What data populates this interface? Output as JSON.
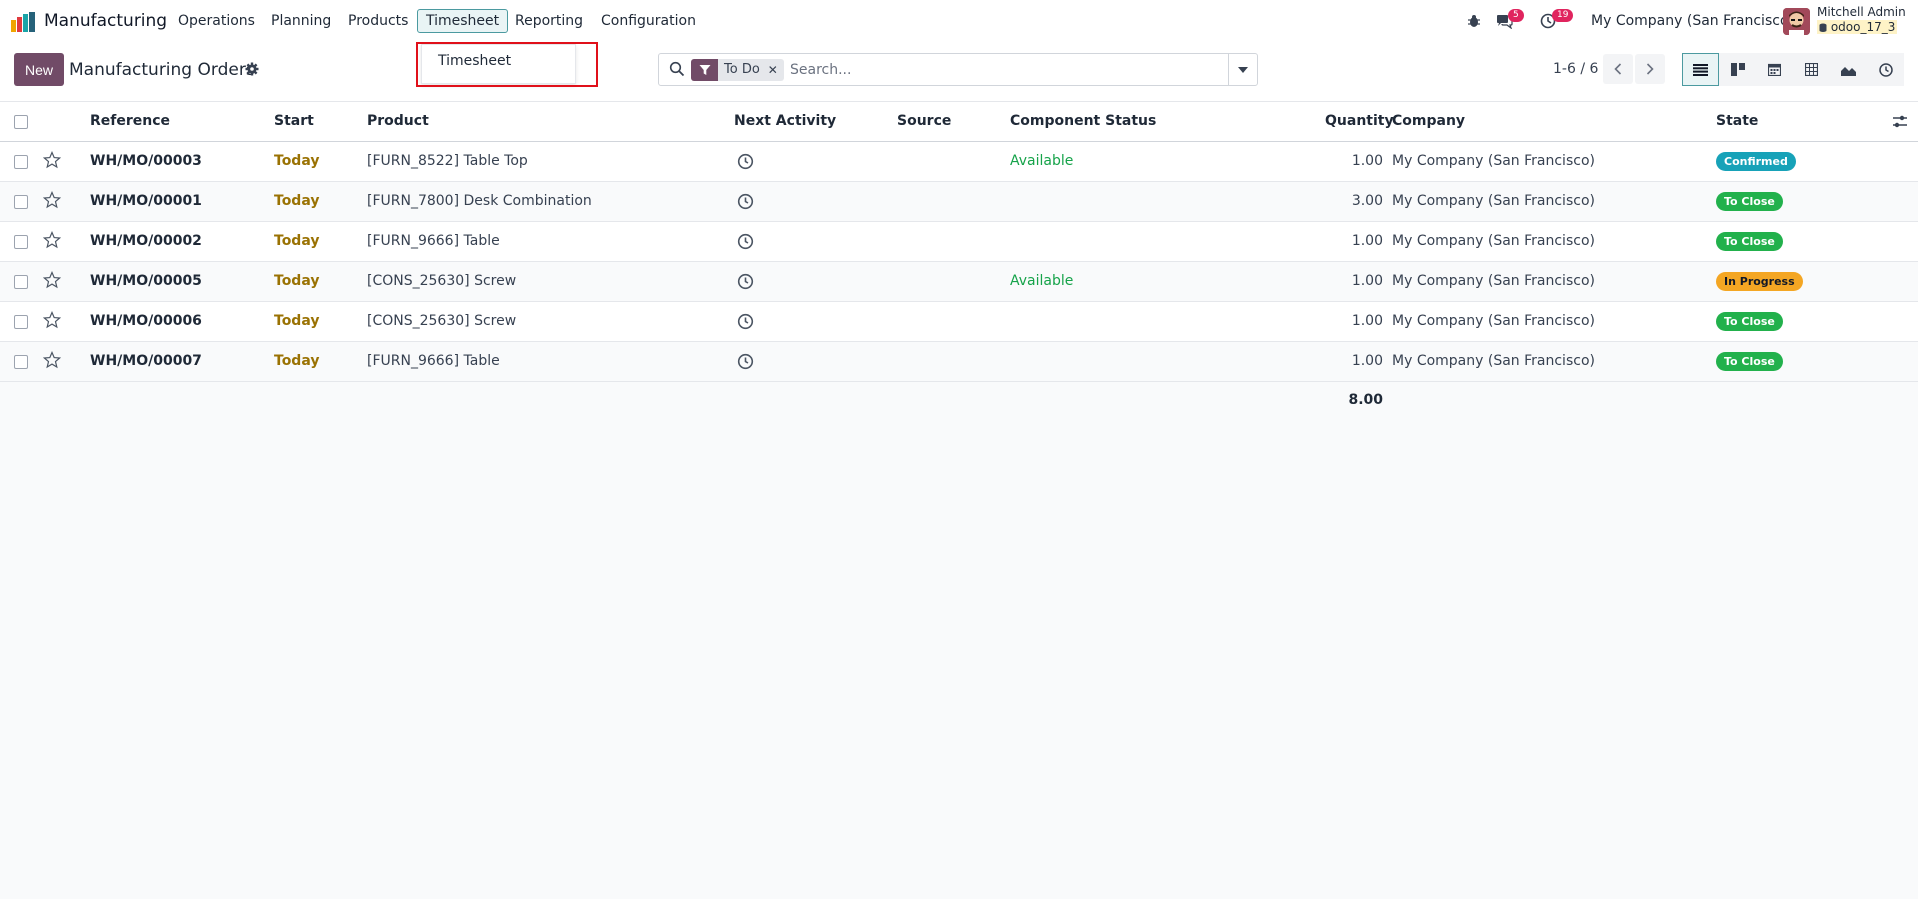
{
  "navbar": {
    "app_name": "Manufacturing",
    "menu": [
      "Operations",
      "Planning",
      "Products",
      "Timesheet",
      "Reporting",
      "Configuration"
    ],
    "active_menu": "Timesheet",
    "messages_count": "5",
    "activities_count": "19",
    "company": "My Company (San Francisco)",
    "user_name": "Mitchell Admin",
    "db_name": "odoo_17_3"
  },
  "dropdown": {
    "items": [
      "Timesheet"
    ]
  },
  "control_panel": {
    "new_label": "New",
    "breadcrumb": "Manufacturing Orders",
    "search": {
      "facet": "To Do",
      "placeholder": "Search..."
    },
    "pager": "1-6 / 6"
  },
  "table": {
    "headers": {
      "reference": "Reference",
      "start": "Start",
      "product": "Product",
      "next_activity": "Next Activity",
      "source": "Source",
      "component_status": "Component Status",
      "quantity": "Quantity",
      "company": "Company",
      "state": "State"
    },
    "rows": [
      {
        "reference": "WH/MO/00003",
        "start": "Today",
        "product": "[FURN_8522] Table Top",
        "component_status": "Available",
        "quantity": "1.00",
        "company": "My Company (San Francisco)",
        "state": "Confirmed",
        "state_color": "#17a2b8"
      },
      {
        "reference": "WH/MO/00001",
        "start": "Today",
        "product": "[FURN_7800] Desk Combination",
        "component_status": "",
        "quantity": "3.00",
        "company": "My Company (San Francisco)",
        "state": "To Close",
        "state_color": "#22b14c"
      },
      {
        "reference": "WH/MO/00002",
        "start": "Today",
        "product": "[FURN_9666] Table",
        "component_status": "",
        "quantity": "1.00",
        "company": "My Company (San Francisco)",
        "state": "To Close",
        "state_color": "#22b14c"
      },
      {
        "reference": "WH/MO/00005",
        "start": "Today",
        "product": "[CONS_25630] Screw",
        "component_status": "Available",
        "quantity": "1.00",
        "company": "My Company (San Francisco)",
        "state": "In Progress",
        "state_color": "#f4a623"
      },
      {
        "reference": "WH/MO/00006",
        "start": "Today",
        "product": "[CONS_25630] Screw",
        "component_status": "",
        "quantity": "1.00",
        "company": "My Company (San Francisco)",
        "state": "To Close",
        "state_color": "#22b14c"
      },
      {
        "reference": "WH/MO/00007",
        "start": "Today",
        "product": "[FURN_9666] Table",
        "component_status": "",
        "quantity": "1.00",
        "company": "My Company (San Francisco)",
        "state": "To Close",
        "state_color": "#22b14c"
      }
    ],
    "total_quantity": "8.00"
  },
  "colors": {
    "brand": "#714b67",
    "highlight": "#e0101a",
    "today": "#9a7203",
    "available": "#16a34a"
  }
}
